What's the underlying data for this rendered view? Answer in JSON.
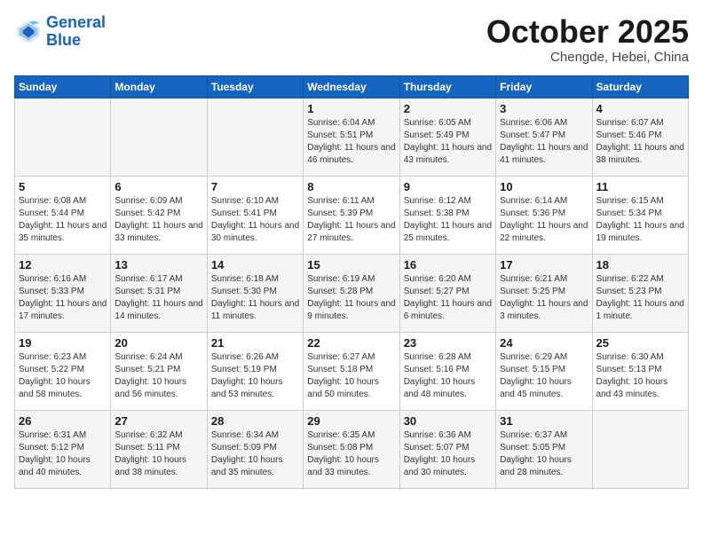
{
  "header": {
    "logo_line1": "General",
    "logo_line2": "Blue",
    "month": "October 2025",
    "location": "Chengde, Hebei, China"
  },
  "weekdays": [
    "Sunday",
    "Monday",
    "Tuesday",
    "Wednesday",
    "Thursday",
    "Friday",
    "Saturday"
  ],
  "weeks": [
    [
      {
        "day": "",
        "info": ""
      },
      {
        "day": "",
        "info": ""
      },
      {
        "day": "",
        "info": ""
      },
      {
        "day": "1",
        "info": "Sunrise: 6:04 AM\nSunset: 5:51 PM\nDaylight: 11 hours and 46 minutes."
      },
      {
        "day": "2",
        "info": "Sunrise: 6:05 AM\nSunset: 5:49 PM\nDaylight: 11 hours and 43 minutes."
      },
      {
        "day": "3",
        "info": "Sunrise: 6:06 AM\nSunset: 5:47 PM\nDaylight: 11 hours and 41 minutes."
      },
      {
        "day": "4",
        "info": "Sunrise: 6:07 AM\nSunset: 5:46 PM\nDaylight: 11 hours and 38 minutes."
      }
    ],
    [
      {
        "day": "5",
        "info": "Sunrise: 6:08 AM\nSunset: 5:44 PM\nDaylight: 11 hours and 35 minutes."
      },
      {
        "day": "6",
        "info": "Sunrise: 6:09 AM\nSunset: 5:42 PM\nDaylight: 11 hours and 33 minutes."
      },
      {
        "day": "7",
        "info": "Sunrise: 6:10 AM\nSunset: 5:41 PM\nDaylight: 11 hours and 30 minutes."
      },
      {
        "day": "8",
        "info": "Sunrise: 6:11 AM\nSunset: 5:39 PM\nDaylight: 11 hours and 27 minutes."
      },
      {
        "day": "9",
        "info": "Sunrise: 6:12 AM\nSunset: 5:38 PM\nDaylight: 11 hours and 25 minutes."
      },
      {
        "day": "10",
        "info": "Sunrise: 6:14 AM\nSunset: 5:36 PM\nDaylight: 11 hours and 22 minutes."
      },
      {
        "day": "11",
        "info": "Sunrise: 6:15 AM\nSunset: 5:34 PM\nDaylight: 11 hours and 19 minutes."
      }
    ],
    [
      {
        "day": "12",
        "info": "Sunrise: 6:16 AM\nSunset: 5:33 PM\nDaylight: 11 hours and 17 minutes."
      },
      {
        "day": "13",
        "info": "Sunrise: 6:17 AM\nSunset: 5:31 PM\nDaylight: 11 hours and 14 minutes."
      },
      {
        "day": "14",
        "info": "Sunrise: 6:18 AM\nSunset: 5:30 PM\nDaylight: 11 hours and 11 minutes."
      },
      {
        "day": "15",
        "info": "Sunrise: 6:19 AM\nSunset: 5:28 PM\nDaylight: 11 hours and 9 minutes."
      },
      {
        "day": "16",
        "info": "Sunrise: 6:20 AM\nSunset: 5:27 PM\nDaylight: 11 hours and 6 minutes."
      },
      {
        "day": "17",
        "info": "Sunrise: 6:21 AM\nSunset: 5:25 PM\nDaylight: 11 hours and 3 minutes."
      },
      {
        "day": "18",
        "info": "Sunrise: 6:22 AM\nSunset: 5:23 PM\nDaylight: 11 hours and 1 minute."
      }
    ],
    [
      {
        "day": "19",
        "info": "Sunrise: 6:23 AM\nSunset: 5:22 PM\nDaylight: 10 hours and 58 minutes."
      },
      {
        "day": "20",
        "info": "Sunrise: 6:24 AM\nSunset: 5:21 PM\nDaylight: 10 hours and 56 minutes."
      },
      {
        "day": "21",
        "info": "Sunrise: 6:26 AM\nSunset: 5:19 PM\nDaylight: 10 hours and 53 minutes."
      },
      {
        "day": "22",
        "info": "Sunrise: 6:27 AM\nSunset: 5:18 PM\nDaylight: 10 hours and 50 minutes."
      },
      {
        "day": "23",
        "info": "Sunrise: 6:28 AM\nSunset: 5:16 PM\nDaylight: 10 hours and 48 minutes."
      },
      {
        "day": "24",
        "info": "Sunrise: 6:29 AM\nSunset: 5:15 PM\nDaylight: 10 hours and 45 minutes."
      },
      {
        "day": "25",
        "info": "Sunrise: 6:30 AM\nSunset: 5:13 PM\nDaylight: 10 hours and 43 minutes."
      }
    ],
    [
      {
        "day": "26",
        "info": "Sunrise: 6:31 AM\nSunset: 5:12 PM\nDaylight: 10 hours and 40 minutes."
      },
      {
        "day": "27",
        "info": "Sunrise: 6:32 AM\nSunset: 5:11 PM\nDaylight: 10 hours and 38 minutes."
      },
      {
        "day": "28",
        "info": "Sunrise: 6:34 AM\nSunset: 5:09 PM\nDaylight: 10 hours and 35 minutes."
      },
      {
        "day": "29",
        "info": "Sunrise: 6:35 AM\nSunset: 5:08 PM\nDaylight: 10 hours and 33 minutes."
      },
      {
        "day": "30",
        "info": "Sunrise: 6:36 AM\nSunset: 5:07 PM\nDaylight: 10 hours and 30 minutes."
      },
      {
        "day": "31",
        "info": "Sunrise: 6:37 AM\nSunset: 5:05 PM\nDaylight: 10 hours and 28 minutes."
      },
      {
        "day": "",
        "info": ""
      }
    ]
  ]
}
